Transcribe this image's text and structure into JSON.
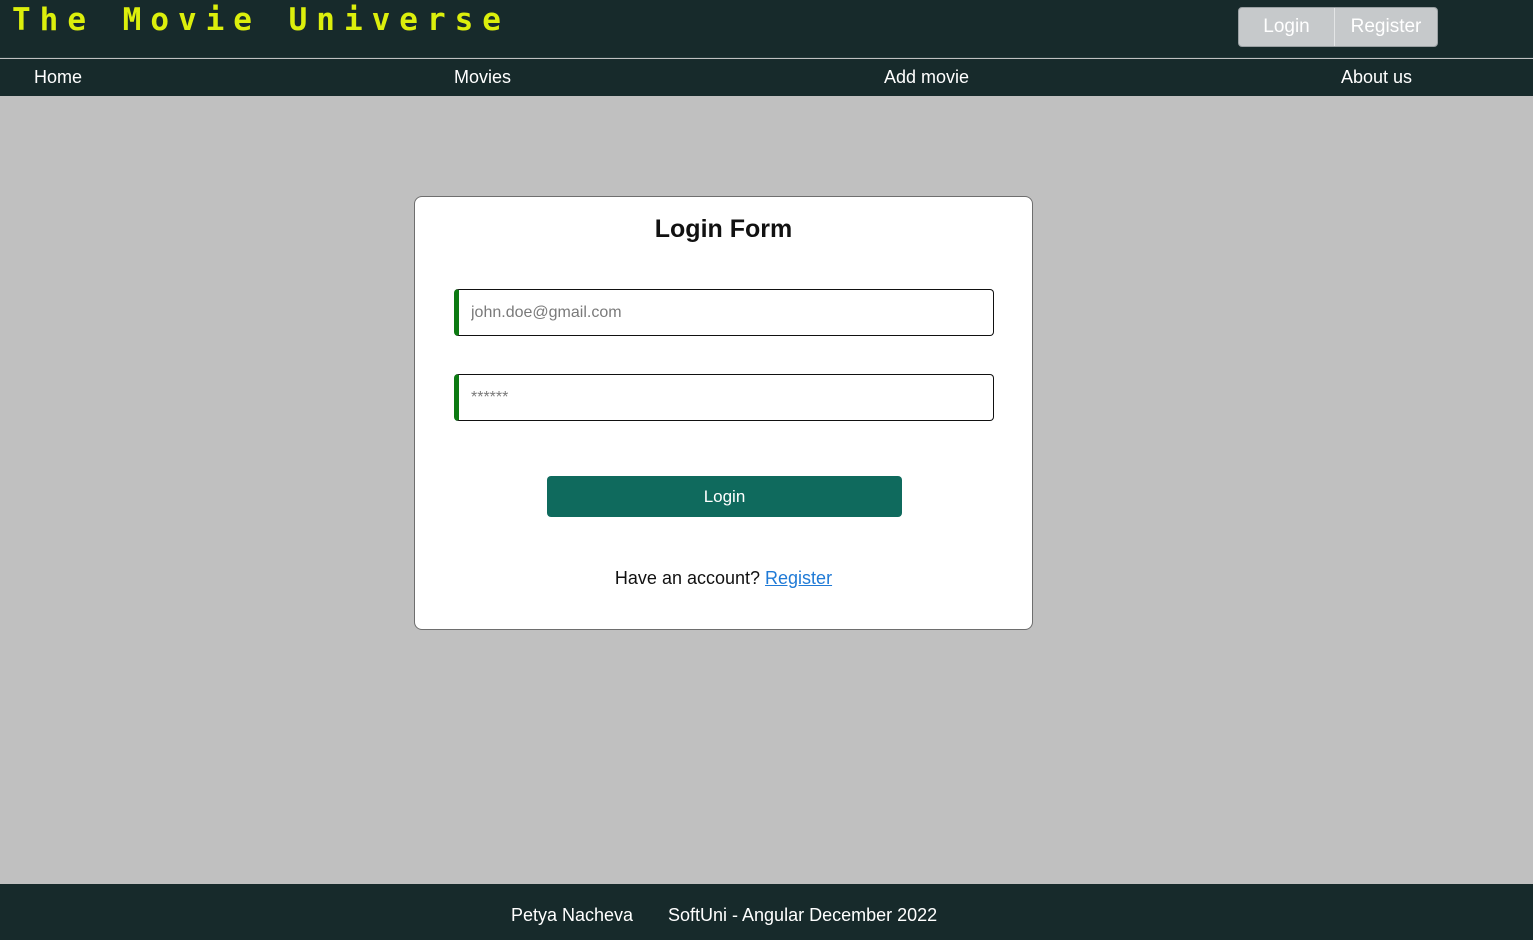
{
  "header": {
    "site_title": "The Movie Universe",
    "login_label": "Login",
    "register_label": "Register"
  },
  "nav": {
    "home": "Home",
    "movies": "Movies",
    "add_movie": "Add movie",
    "about": "About us"
  },
  "login_form": {
    "title": "Login Form",
    "email_placeholder": "john.doe@gmail.com",
    "password_placeholder": "******",
    "submit_label": "Login",
    "account_prompt": "Have an account? ",
    "register_link": "Register"
  },
  "footer": {
    "author": "Petya Nacheva",
    "course": "SoftUni - Angular December 2022"
  },
  "colors": {
    "header_bg": "#172a2b",
    "title_yellow": "#dcef0c",
    "page_bg": "#c0c0c0",
    "button_teal": "#0f6a5d",
    "input_accent_green": "#0c7a12",
    "link_blue": "#1f7ad6"
  }
}
